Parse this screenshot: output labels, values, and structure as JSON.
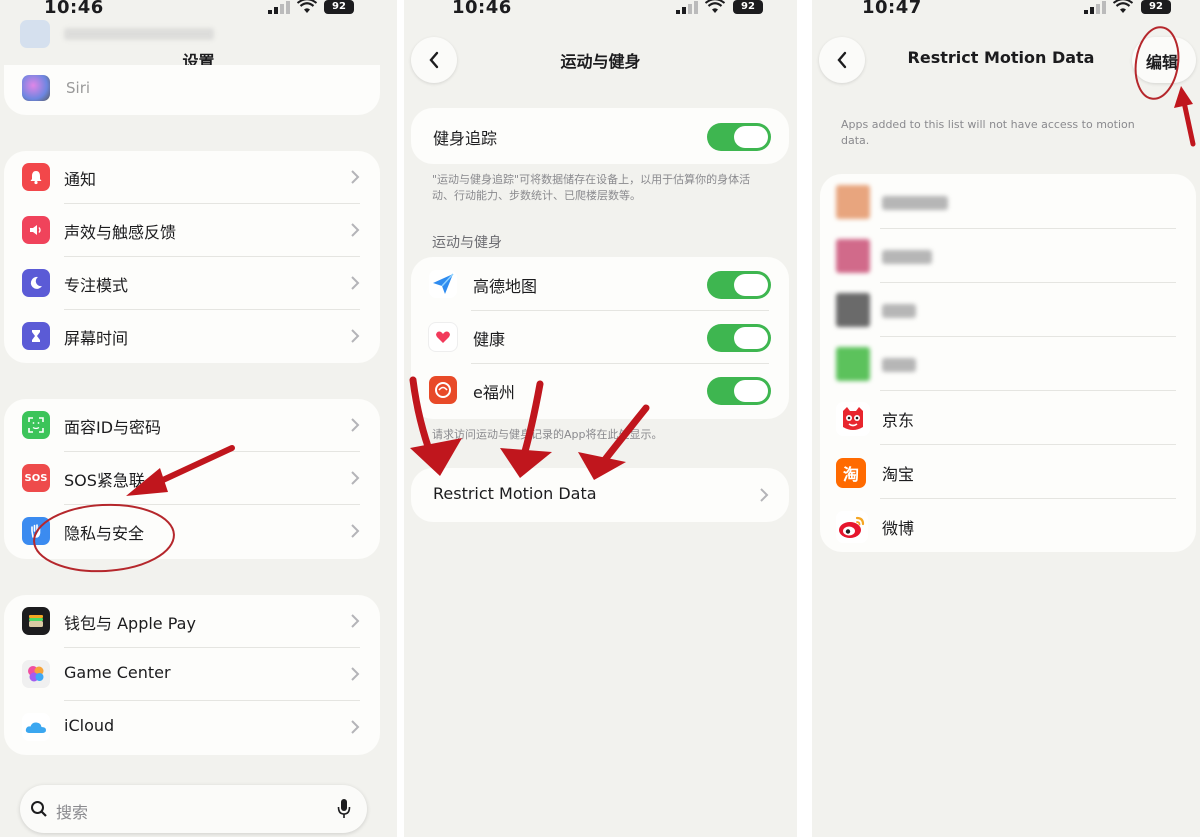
{
  "colors": {
    "background": "#f2f2ee",
    "card": "#fdfdfb",
    "toggle_on": "#3eb650",
    "annotation_red": "#c0161d"
  },
  "status": {
    "p1_time": "10:46",
    "p2_time": "10:46",
    "p3_time": "10:47",
    "battery": "92"
  },
  "settings": {
    "title": "设置",
    "top_item_label": "Siri",
    "group1": [
      {
        "label": "通知",
        "icon": "bell-icon",
        "color": "#f2474a"
      },
      {
        "label": "声效与触感反馈",
        "icon": "speaker-icon",
        "color": "#f0435b"
      },
      {
        "label": "专注模式",
        "icon": "moon-icon",
        "color": "#5b5bd6"
      },
      {
        "label": "屏幕时间",
        "icon": "hourglass-icon",
        "color": "#5b5bd6"
      }
    ],
    "group2": [
      {
        "label": "面容ID与密码",
        "icon": "faceid-icon",
        "color": "#3cc45a"
      },
      {
        "label": "SOS紧急联",
        "icon": "sos-icon",
        "color": "#ee4b4b",
        "icon_text": "SOS"
      },
      {
        "label": "隐私与安全",
        "icon": "hand-icon",
        "color": "#3b8bf0"
      }
    ],
    "group3": [
      {
        "label": "钱包与 Apple Pay",
        "icon": "wallet-icon",
        "color": "#1c1c1e"
      },
      {
        "label": "Game Center",
        "icon": "game-center-icon",
        "color": "#f0f0f0"
      },
      {
        "label": "iCloud",
        "icon": "cloud-icon",
        "color": "#ffffff"
      }
    ],
    "search_placeholder": "搜索"
  },
  "motion": {
    "title": "运动与健身",
    "fitness_tracking_label": "健身追踪",
    "fitness_note": "\"运动与健身追踪\"可将数据储存在设备上，以用于估算你的身体活动、行动能力、步数统计、已爬楼层数等。",
    "section_label": "运动与健身",
    "apps": [
      {
        "label": "高德地图",
        "icon": "amap-icon",
        "color": "#2f8cf0"
      },
      {
        "label": "健康",
        "icon": "heart-icon",
        "color": "#ffffff"
      },
      {
        "label": "e福州",
        "icon": "efuzhou-icon",
        "color": "#e84a28"
      }
    ],
    "apps_note": "请求访问运动与健身记录的App将在此处显示。",
    "restrict_label": "Restrict Motion Data"
  },
  "restrict": {
    "title": "Restrict Motion Data",
    "edit_label": "编辑",
    "note": "Apps added to this list will not have access to motion data.",
    "apps": [
      {
        "label": "京东",
        "icon": "jd-icon",
        "color": "#e8262e"
      },
      {
        "label": "淘宝",
        "icon": "taobao-icon",
        "color": "#ff6a00",
        "icon_text": "淘"
      },
      {
        "label": "微博",
        "icon": "weibo-icon",
        "color": "#e6162d"
      }
    ]
  }
}
